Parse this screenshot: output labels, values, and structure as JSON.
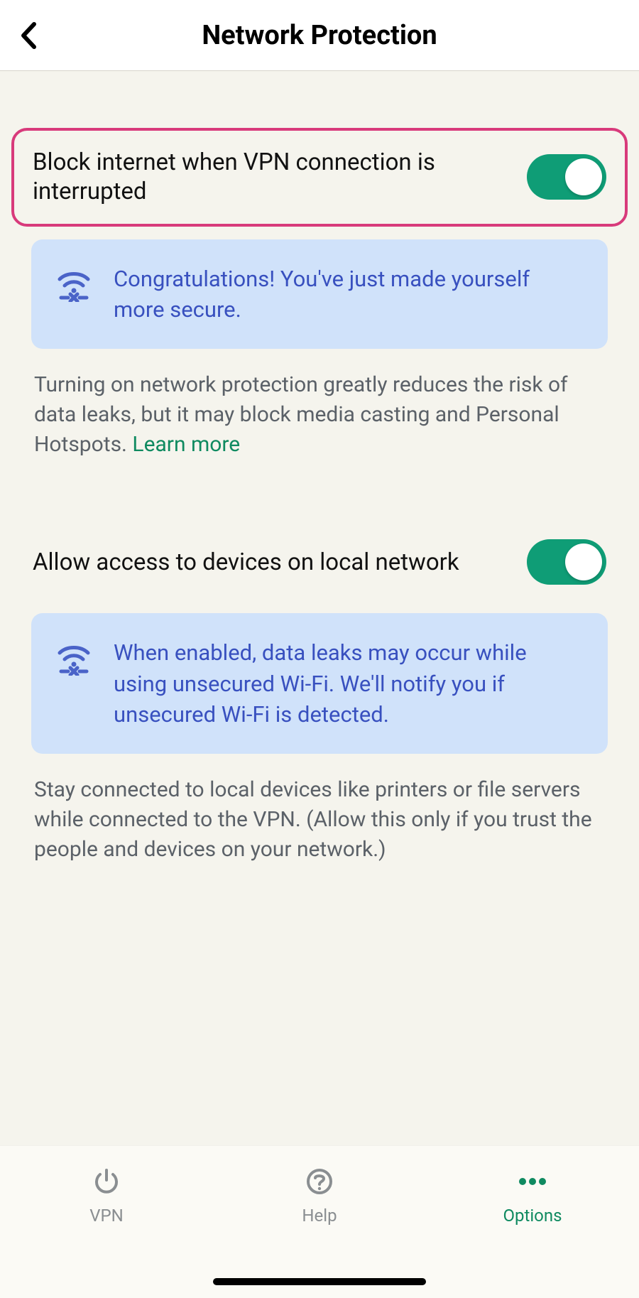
{
  "header": {
    "title": "Network Protection"
  },
  "section1": {
    "label": "Block internet when VPN connection is interrupted",
    "info": "Congratulations! You've just made yourself more secure.",
    "desc": "Turning on network protection greatly reduces the risk of data leaks, but it may block media casting and Personal Hotspots. ",
    "learn_more": "Learn more"
  },
  "section2": {
    "label": "Allow access to devices on local network",
    "info": "When enabled, data leaks may occur while using unsecured Wi-Fi. We'll notify you if unsecured Wi-Fi is detected.",
    "desc": "Stay connected to local devices like printers or file servers while connected to the VPN. (Allow this only if you trust the people and devices on your network.)"
  },
  "tabs": {
    "vpn": "VPN",
    "help": "Help",
    "options": "Options"
  }
}
